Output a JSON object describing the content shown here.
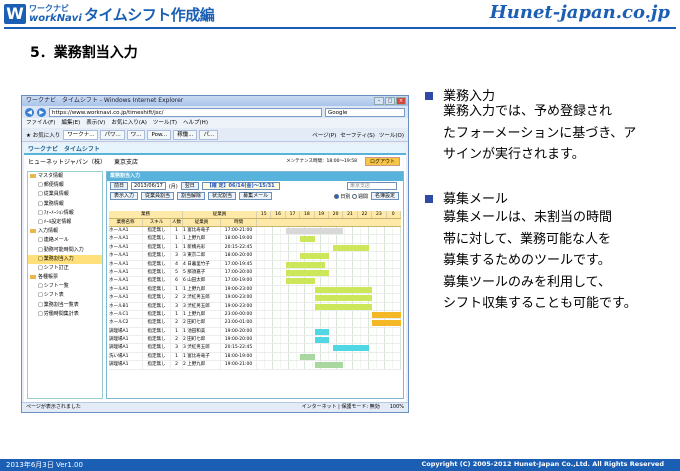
{
  "header": {
    "logo_letter": "W",
    "logo_small": "ワークナビ",
    "logo_sub": "workNavi",
    "title": "タイムシフト作成編",
    "brand": "Hunet-japan.co.jp"
  },
  "section_title": "5．業務割当入力",
  "browser": {
    "window_title": "ワークナビ　タイムシフト - Windows Internet Explorer",
    "address": "https://www.worknavi.co.jp/timeshift/jsc/",
    "search_placeholder": "Google",
    "menu": [
      "ファイル(F)",
      "編集(E)",
      "表示(V)",
      "お気に入り(A)",
      "ツール(T)",
      "ヘルプ(H)"
    ],
    "favorites_label": "お気に入り",
    "tabs": [
      "ワークナ...",
      "パワ...",
      "ワ...",
      "Pow...",
      "稼働...",
      "パ..."
    ],
    "tools": [
      "ページ(P)",
      "セーフティ(S)",
      "ツール(O)"
    ],
    "status_left": "ページが表示されました",
    "status_zone": "インターネット | 保護モード: 無効",
    "status_zoom": "100%"
  },
  "app": {
    "header": "ワークナビ　タイムシフト",
    "company": "ヒューネットジャパン（株）",
    "branch": "東京支店",
    "maintenance": "メンテナンス時間：18:00〜19:58",
    "logout": "ログアウト",
    "sidebar": [
      {
        "label": "マスタ情報",
        "kind": "cat"
      },
      {
        "label": "郵便情報",
        "kind": "sub"
      },
      {
        "label": "従業員情報",
        "kind": "sub"
      },
      {
        "label": "業務情報",
        "kind": "sub"
      },
      {
        "label": "ﾌｫｰﾒｰｼｮﾝ情報",
        "kind": "sub"
      },
      {
        "label": "ﾒｰﾙ設定情報",
        "kind": "sub"
      },
      {
        "label": "入力情報",
        "kind": "cat"
      },
      {
        "label": "連絡メール",
        "kind": "sub"
      },
      {
        "label": "勤務可能時間入力",
        "kind": "sub"
      },
      {
        "label": "業務割当入力",
        "kind": "sub",
        "active": true
      },
      {
        "label": "シフト訂正",
        "kind": "sub"
      },
      {
        "label": "各種帳票",
        "kind": "cat"
      },
      {
        "label": "シフト一覧",
        "kind": "sub"
      },
      {
        "label": "シフト表",
        "kind": "sub"
      },
      {
        "label": "業務割当一覧表",
        "kind": "sub"
      },
      {
        "label": "労働時間集計表",
        "kind": "sub"
      }
    ],
    "panel_title": "業務割当入力",
    "prev_label": "前日",
    "date_value": "2013/06/17",
    "weekday": "(月)",
    "next_label": "翌日",
    "week_range": "【確 定】06/14(金)〜15/31",
    "branch_select": "東京支店",
    "actions": [
      "表示入力",
      "従業員割当",
      "割当解除",
      "状況割当",
      "募集メール"
    ],
    "radio_daily": "日別",
    "radio_weekly": "週間",
    "layout_setting": "名簿設定",
    "col_task": "業務",
    "col_staff": "従業員",
    "col_task_name": "業務名称",
    "col_skill": "スキル",
    "col_people": "人数",
    "col_employee": "従業員",
    "col_time": "時間",
    "hours": [
      "15",
      "16",
      "17",
      "18",
      "19",
      "20",
      "21",
      "22",
      "23",
      "0"
    ],
    "rows": [
      {
        "task": "ホールA1",
        "skill": "指定無し",
        "n": "1",
        "emp": "1 富比寿竜子",
        "time": "17:00-21:00",
        "bar_start": 17,
        "bar_end": 21,
        "color": "#d8d8d8"
      },
      {
        "task": "ホールA1",
        "skill": "指定無し",
        "n": "1",
        "emp": "1 上野九郎",
        "time": "18:00-19:00",
        "bar_start": 18,
        "bar_end": 19,
        "color": "#cce85a"
      },
      {
        "task": "ホールA1",
        "skill": "指定無し",
        "n": "1",
        "emp": "1 新橋光彩",
        "time": "20:15-22:45",
        "bar_start": 20.25,
        "bar_end": 22.75,
        "color": "#cce85a"
      },
      {
        "task": "ホールA1",
        "skill": "指定無し",
        "n": "3",
        "emp": "3 東京二郎",
        "time": "18:00-20:00",
        "bar_start": 18,
        "bar_end": 20,
        "color": "#cce85a"
      },
      {
        "task": "ホールA1",
        "skill": "指定無し",
        "n": "4",
        "emp": "4 日暮里竹子",
        "time": "17:00-19:45",
        "bar_start": 17,
        "bar_end": 19.75,
        "color": "#cce85a"
      },
      {
        "task": "ホールA1",
        "skill": "指定無し",
        "n": "5",
        "emp": "5 那須嘉子",
        "time": "17:00-20:00",
        "bar_start": 17,
        "bar_end": 20,
        "color": "#cce85a"
      },
      {
        "task": "ホールA1",
        "skill": "指定無し",
        "n": "6",
        "emp": "6 山田太郎",
        "time": "17:00-19:00",
        "bar_start": 17,
        "bar_end": 19,
        "color": "#cce85a"
      },
      {
        "task": "ホールA1",
        "skill": "指定無し",
        "n": "1",
        "emp": "1 上野九郎",
        "time": "19:00-23:00",
        "bar_start": 19,
        "bar_end": 23,
        "color": "#cce85a"
      },
      {
        "task": "ホールA1",
        "skill": "指定無し",
        "n": "2",
        "emp": "2 渋紅男五郎",
        "time": "19:00-23:00",
        "bar_start": 19,
        "bar_end": 23,
        "color": "#cce85a"
      },
      {
        "task": "ホールB1",
        "skill": "指定無し",
        "n": "3",
        "emp": "3 渋紅男五郎",
        "time": "19:00-23:00",
        "bar_start": 19,
        "bar_end": 23,
        "color": "#cce85a"
      },
      {
        "task": "ホールC1",
        "skill": "指定無し",
        "n": "1",
        "emp": "1 上野九郎",
        "time": "23:00-00:00",
        "bar_start": 23,
        "bar_end": 25,
        "color": "#f4b826"
      },
      {
        "task": "ホールC2",
        "skill": "指定無し",
        "n": "2",
        "emp": "2 田町七郎",
        "time": "23:00-01:00",
        "bar_start": 23,
        "bar_end": 25,
        "color": "#f4b826"
      },
      {
        "task": "調理場A1",
        "skill": "指定無し",
        "n": "1",
        "emp": "1 池田和美",
        "time": "19:00-20:00",
        "bar_start": 19,
        "bar_end": 20,
        "color": "#4fd7e3"
      },
      {
        "task": "調理場A1",
        "skill": "指定無し",
        "n": "2",
        "emp": "2 田町七郎",
        "time": "19:00-20:00",
        "bar_start": 19,
        "bar_end": 20,
        "color": "#4fd7e3"
      },
      {
        "task": "調理場A1",
        "skill": "指定無し",
        "n": "3",
        "emp": "3 渋紅男五郎",
        "time": "20:15-22:45",
        "bar_start": 20.25,
        "bar_end": 22.75,
        "color": "#4fd7e3"
      },
      {
        "task": "洗い場A1",
        "skill": "指定無し",
        "n": "1",
        "emp": "1 富比寿竜子",
        "time": "18:00-19:00",
        "bar_start": 18,
        "bar_end": 19,
        "color": "#a8d8a0"
      },
      {
        "task": "調理場A1",
        "skill": "指定無し",
        "n": "2",
        "emp": "2 上野九郎",
        "time": "19:00-21:00",
        "bar_start": 19,
        "bar_end": 21,
        "color": "#a8d8a0"
      }
    ]
  },
  "right_panel": {
    "item1_heading": "業務入力",
    "item1_lines": [
      "業務入力では、予め登録され",
      "たフォーメーションに基づき、ア",
      "サインが実行されます。"
    ],
    "item2_heading": "募集メール",
    "item2_lines": [
      "募集メールは、未割当の時間",
      "帯に対して、業務可能な人を",
      "募集するためのツールです。",
      "募集ツールのみを利用して、",
      "シフト収集することも可能です。"
    ],
    "bullet_color": "#2c4aa6"
  },
  "footer": {
    "left": "2013年6月3日 Ver1.00",
    "right": "Copyright (C) 2005-2012 Hunet-Japan Co.,Ltd. All Rights Reserved"
  }
}
